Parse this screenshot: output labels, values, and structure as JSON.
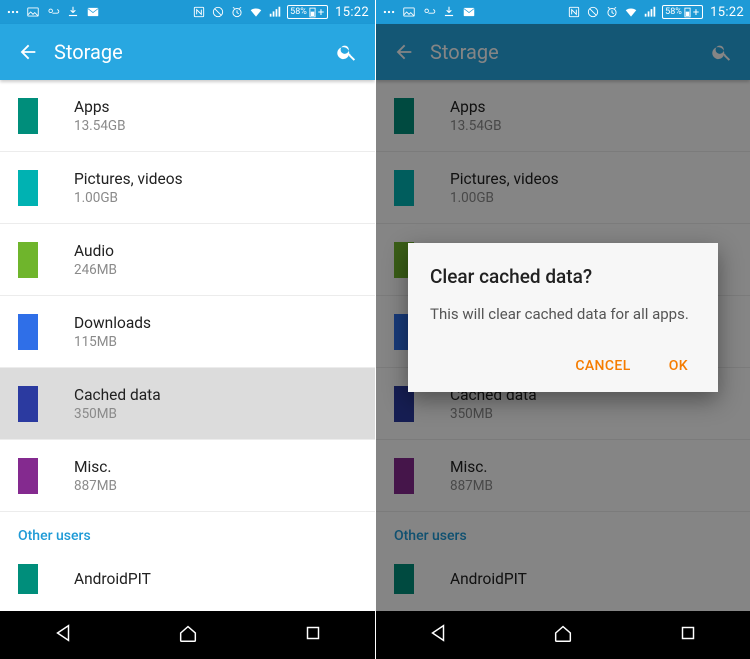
{
  "status": {
    "battery": "58%",
    "time": "15:22"
  },
  "appbar": {
    "title": "Storage"
  },
  "items": [
    {
      "title": "Apps",
      "sub": "13.54GB",
      "color": "#008e7b"
    },
    {
      "title": "Pictures, videos",
      "sub": "1.00GB",
      "color": "#00b2b2"
    },
    {
      "title": "Audio",
      "sub": "246MB",
      "color": "#6fb52c"
    },
    {
      "title": "Downloads",
      "sub": "115MB",
      "color": "#2f6fe8"
    },
    {
      "title": "Cached data",
      "sub": "350MB",
      "color": "#2b3aa0"
    },
    {
      "title": "Misc.",
      "sub": "887MB",
      "color": "#842a8f"
    }
  ],
  "section": "Other users",
  "other": {
    "title": "AndroidPIT",
    "color": "#008e7b"
  },
  "dialog": {
    "title": "Clear cached data?",
    "message": "This will clear cached data for all apps.",
    "cancel": "CANCEL",
    "ok": "OK"
  }
}
